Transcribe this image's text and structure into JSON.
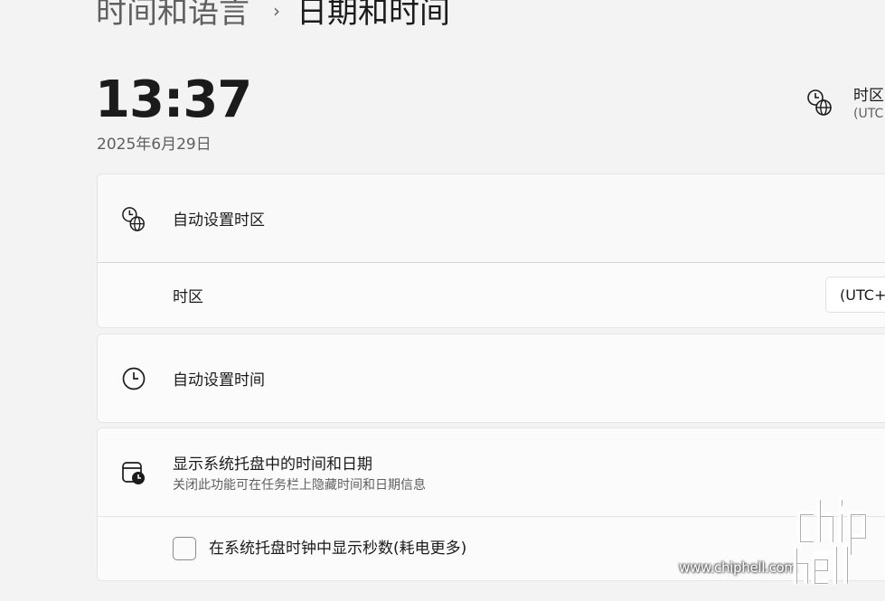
{
  "breadcrumb": {
    "parent": "时间和语言",
    "separator": "›",
    "current": "日期和时间"
  },
  "clock": {
    "time": "13:37",
    "date": "2025年6月29日"
  },
  "timezone_info": {
    "icon": "clock-globe-icon",
    "title": "时区",
    "value": "(UTC"
  },
  "settings": {
    "auto_timezone": {
      "icon": "clock-globe-icon",
      "label": "自动设置时区"
    },
    "timezone": {
      "label": "时区",
      "selected": "(UTC+"
    },
    "auto_time": {
      "icon": "clock-icon",
      "label": "自动设置时间"
    },
    "tray": {
      "icon": "calendar-clock-icon",
      "label": "显示系统托盘中的时间和日期",
      "description": "关闭此功能可在任务栏上隐藏时间和日期信息",
      "seconds_checked": false,
      "seconds_label": "在系统托盘时钟中显示秒数(耗电更多)"
    }
  },
  "watermark": {
    "url": "www.chiphell.com",
    "logo_text": "chip hell"
  },
  "colors": {
    "background": "#f3f3f3",
    "card": "#fbfbfb",
    "text": "#1b1b1b",
    "secondary_text": "#5f5f5f"
  }
}
